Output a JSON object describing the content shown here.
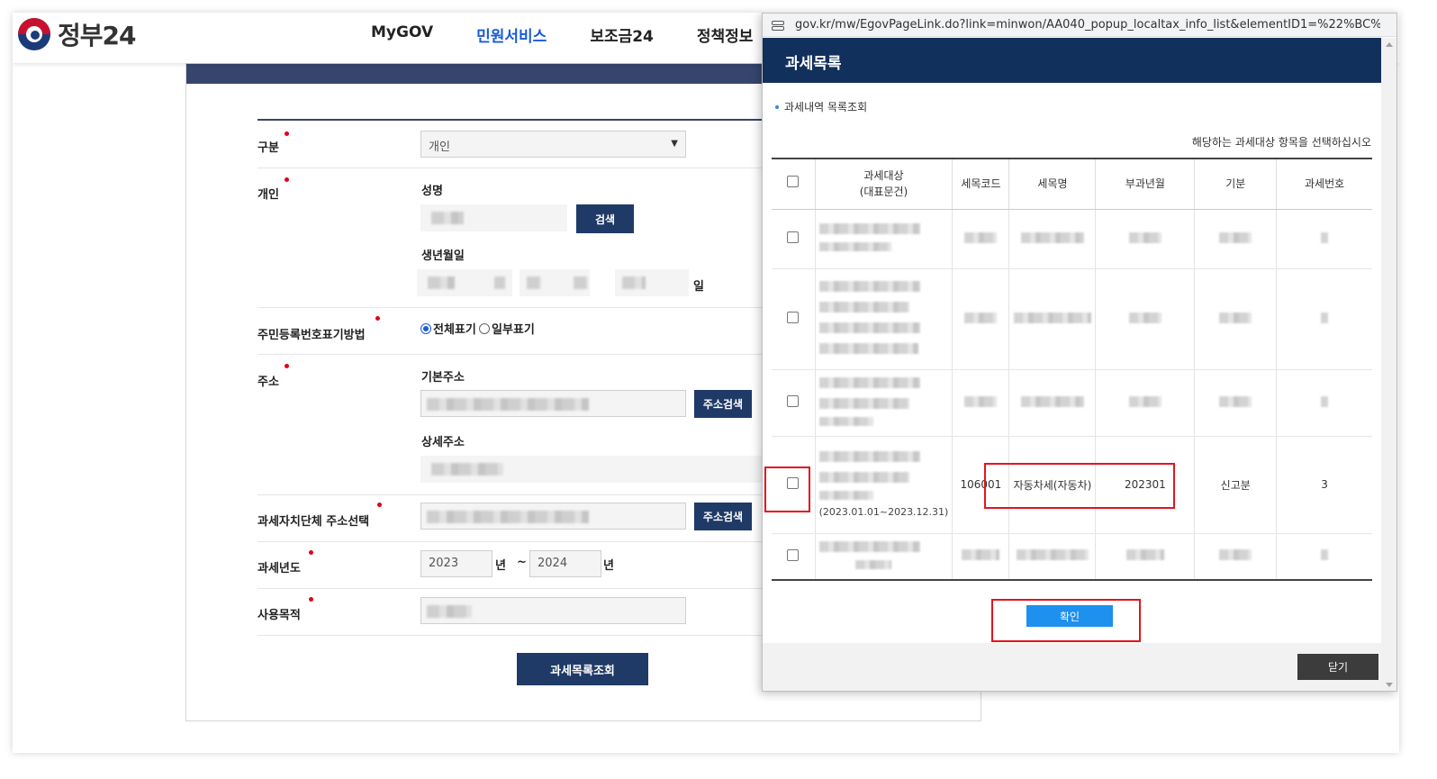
{
  "header": {
    "logo_text": "정부24",
    "nav": [
      "MyGOV",
      "민원서비스",
      "보조금24",
      "정책정보"
    ],
    "active_nav": "민원서비스"
  },
  "form": {
    "section_label": "구분",
    "section_value": "개인",
    "personal_label": "개인",
    "name_label": "성명",
    "search_button": "검색",
    "birth_label": "생년월일",
    "day_unit": "일",
    "rrn_label": "주민등록번호표기방법",
    "rrn_options": [
      "전체표기",
      "일부표기"
    ],
    "address_label": "주소",
    "basic_address_label": "기본주소",
    "address_search_button": "주소검색",
    "detail_address_label": "상세주소",
    "tax_org_label": "과세자치단체 주소선택",
    "tax_org_search_button": "주소검색",
    "tax_year_label": "과세년도",
    "tax_year_from": "2023",
    "year_unit": "년",
    "tilde": "~",
    "tax_year_to": "2024",
    "purpose_label": "사용목적",
    "submit_button": "과세목록조회"
  },
  "popup": {
    "url": "gov.kr/mw/EgovPageLink.do?link=minwon/AA040_popup_localtax_info_list&elementID1=%22%BC%BC...",
    "title": "과세목록",
    "section_title": "과세내역 목록조회",
    "instruction": "해당하는 과세대상 항목을 선택하십시오",
    "columns": [
      "과세대상\n(대표문건)",
      "세목코드",
      "세목명",
      "부과년월",
      "기분",
      "과세번호"
    ],
    "visible_row": {
      "period": "(2023.01.01~2023.12.31)",
      "code": "106001",
      "tax_name": "자동차세(자동차)",
      "month": "202301",
      "type": "신고분",
      "number": "3"
    },
    "confirm_button": "확인",
    "close_button": "닫기"
  },
  "colors": {
    "navy": "#1f3a66",
    "popup_header": "#12305c",
    "accent_blue": "#1a5bd8",
    "highlight_red": "#e3141e",
    "confirm_blue": "#1e90ee"
  }
}
